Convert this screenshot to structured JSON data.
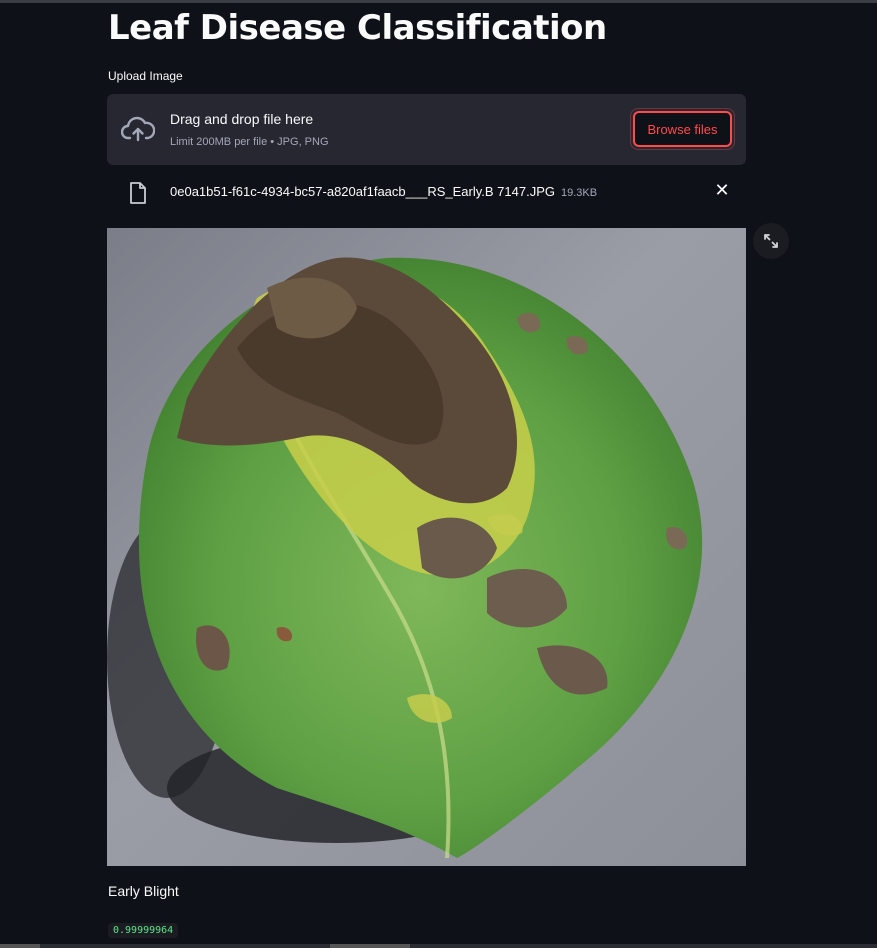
{
  "app": {
    "title": "Leaf Disease Classification"
  },
  "uploader": {
    "label": "Upload Image",
    "drop_title": "Drag and drop file here",
    "drop_subtitle": "Limit 200MB per file • JPG, PNG",
    "browse_label": "Browse files",
    "cloud_icon": "cloud-upload-icon"
  },
  "file": {
    "name": "0e0a1b51-f61c-4934-bc57-a820af1faacb___RS_Early.B 7147.JPG",
    "size": "19.3KB",
    "icon": "file-icon",
    "remove_icon": "close-icon"
  },
  "image": {
    "expand_icon": "fullscreen-icon"
  },
  "prediction": {
    "label": "Early Blight",
    "confidence": "0.99999964"
  },
  "colors": {
    "background": "#0e1117",
    "accent": "#ff4b4b",
    "dropzone": "#262730",
    "score_text": "#5ce488"
  }
}
